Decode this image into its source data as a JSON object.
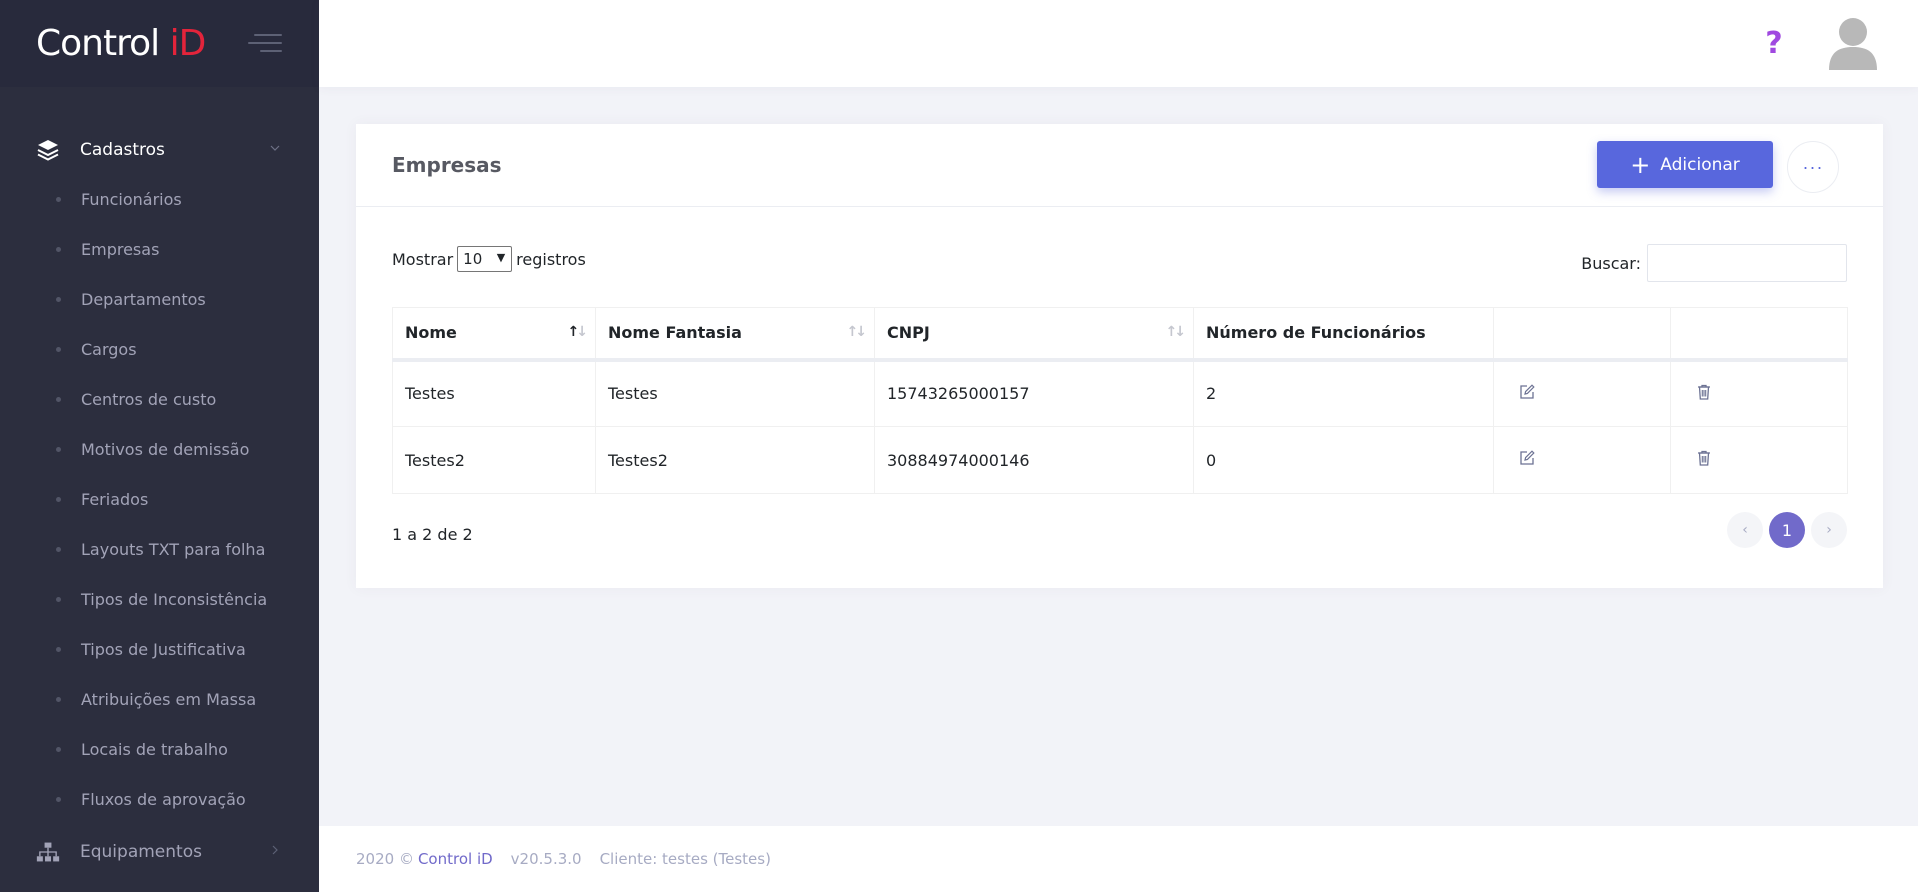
{
  "brand": {
    "name_main": "Control ",
    "name_accent": "iD"
  },
  "sidebar": {
    "sections": [
      {
        "label": "Cadastros",
        "icon": "layers-icon",
        "items": [
          "Funcionários",
          "Empresas",
          "Departamentos",
          "Cargos",
          "Centros de custo",
          "Motivos de demissão",
          "Feriados",
          "Layouts TXT para folha",
          "Tipos de Inconsistência",
          "Tipos de Justificativa",
          "Atribuições em Massa",
          "Locais de trabalho",
          "Fluxos de aprovação"
        ]
      },
      {
        "label": "Equipamentos",
        "icon": "sitemap-icon"
      }
    ]
  },
  "header": {
    "help_symbol": "?"
  },
  "page": {
    "title": "Empresas",
    "add_label": "Adicionar",
    "more_label": "···",
    "show_prefix": "Mostrar",
    "show_value": "10",
    "show_suffix": "registros",
    "search_label": "Buscar:",
    "search_value": ""
  },
  "table": {
    "columns": [
      "Nome",
      "Nome Fantasia",
      "CNPJ",
      "Número de Funcionários",
      "",
      ""
    ],
    "rows": [
      {
        "nome": "Testes",
        "fantasia": "Testes",
        "cnpj": "15743265000157",
        "funcionarios": "2"
      },
      {
        "nome": "Testes2",
        "fantasia": "Testes2",
        "cnpj": "30884974000146",
        "funcionarios": "0"
      }
    ]
  },
  "pagination": {
    "info": "1 a 2 de 2",
    "prev": "‹",
    "current": "1",
    "next": "›"
  },
  "footer": {
    "copyright": "2020 ©",
    "brand": "Control iD",
    "version": "v20.5.3.0",
    "client": "Cliente: testes (Testes)"
  },
  "colors": {
    "sidebar_bg": "#2c2e3e",
    "brand_accent": "#e3243b",
    "primary_button": "#5867dd",
    "pager_active": "#716aca",
    "help_icon": "#a049e0"
  }
}
